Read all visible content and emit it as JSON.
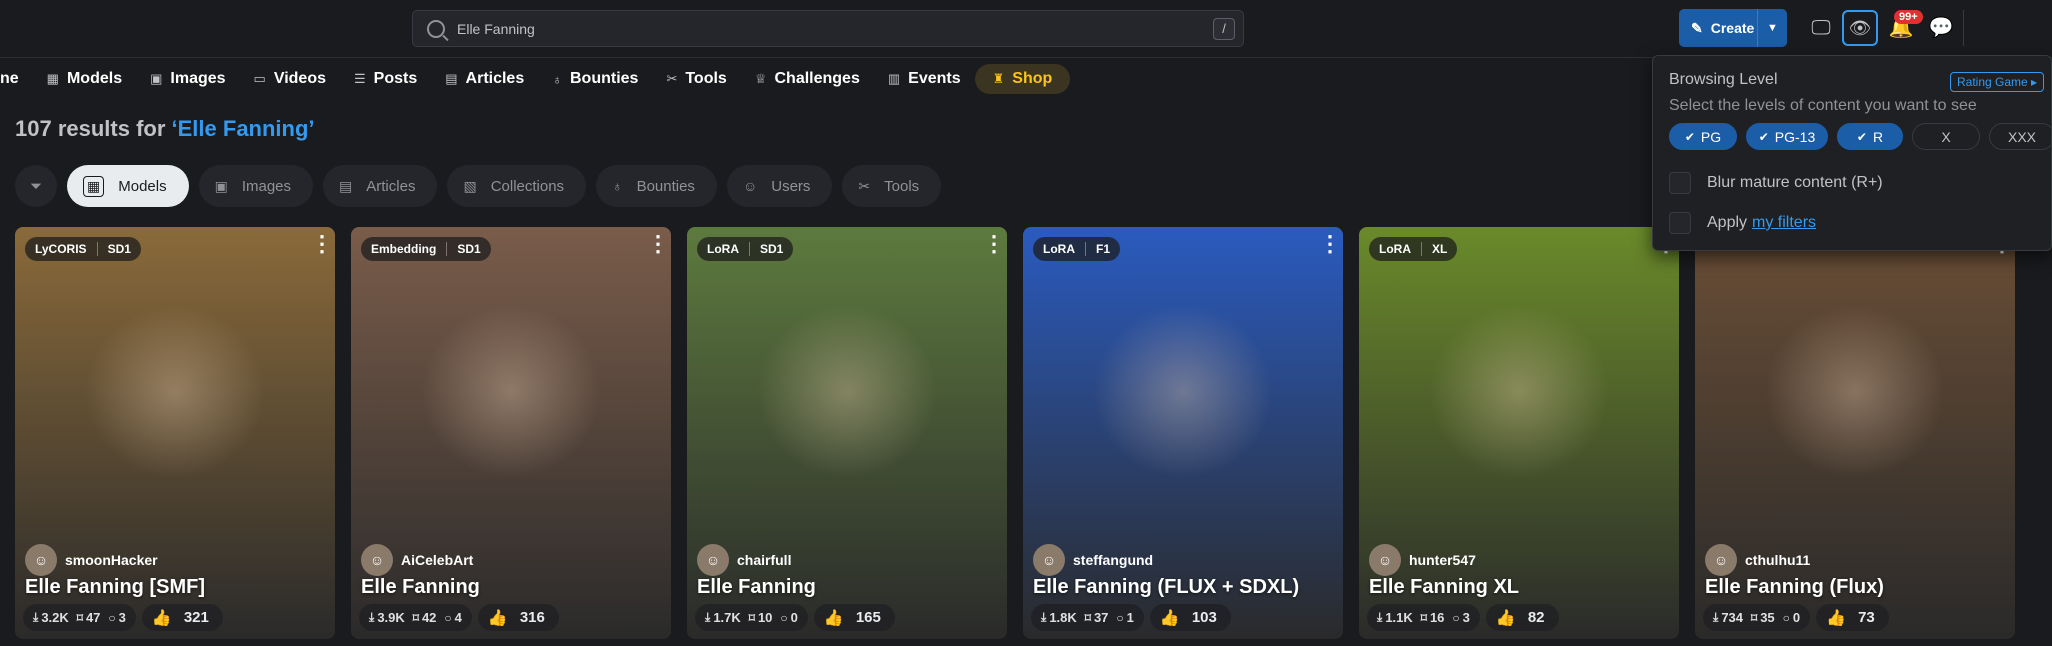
{
  "search": {
    "value": "Elle Fanning",
    "shortcut": "/"
  },
  "header": {
    "create_label": "Create",
    "notifications_badge": "99+"
  },
  "nav": {
    "partial": "ne",
    "items": [
      "Models",
      "Images",
      "Videos",
      "Posts",
      "Articles",
      "Bounties",
      "Tools",
      "Challenges",
      "Events"
    ],
    "shop": "Shop"
  },
  "results": {
    "prefix": "107 results for ",
    "query": "‘Elle Fanning’"
  },
  "tabs": [
    "Models",
    "Images",
    "Articles",
    "Collections",
    "Bounties",
    "Users",
    "Tools"
  ],
  "cards": [
    {
      "type": "LyCORIS",
      "base": "SD1",
      "user": "smoonHacker",
      "title": "Elle Fanning [SMF]",
      "downloads": "3.2K",
      "collected": "47",
      "comments": "3",
      "likes": "321",
      "bg": "#8a6a3a"
    },
    {
      "type": "Embedding",
      "base": "SD1",
      "user": "AiCelebArt",
      "title": "Elle Fanning",
      "downloads": "3.9K",
      "collected": "42",
      "comments": "4",
      "likes": "316",
      "bg": "#7a5c4a"
    },
    {
      "type": "LoRA",
      "base": "SD1",
      "user": "chairfull",
      "title": "Elle Fanning",
      "downloads": "1.7K",
      "collected": "10",
      "comments": "0",
      "likes": "165",
      "bg": "#5d7a3e"
    },
    {
      "type": "LoRA",
      "base": "F1",
      "user": "steffangund",
      "title": "Elle Fanning (FLUX + SDXL)",
      "downloads": "1.8K",
      "collected": "37",
      "comments": "1",
      "likes": "103",
      "bg": "#2a5bbf"
    },
    {
      "type": "LoRA",
      "base": "XL",
      "user": "hunter547",
      "title": "Elle Fanning XL",
      "downloads": "1.1K",
      "collected": "16",
      "comments": "3",
      "likes": "82",
      "bg": "#6a8a2a"
    },
    {
      "type": "",
      "base": "",
      "user": "cthulhu11",
      "title": "Elle Fanning (Flux)",
      "downloads": "734",
      "collected": "35",
      "comments": "0",
      "likes": "73",
      "bg": "#6a4e36"
    }
  ],
  "browsing_panel": {
    "title": "Browsing Level",
    "rating_game": "Rating Game",
    "subtitle": "Select the levels of content you want to see",
    "levels": [
      {
        "label": "PG",
        "selected": true
      },
      {
        "label": "PG-13",
        "selected": true
      },
      {
        "label": "R",
        "selected": true
      },
      {
        "label": "X",
        "selected": false
      },
      {
        "label": "XXX",
        "selected": false
      }
    ],
    "blur_label": "Blur mature content (R+)",
    "apply_label": "Apply",
    "my_filters": "my filters"
  },
  "colors": {
    "accent": "#339af0",
    "primary_button": "#1c5da8",
    "shop": "#fcc419",
    "notification": "#e03131"
  }
}
